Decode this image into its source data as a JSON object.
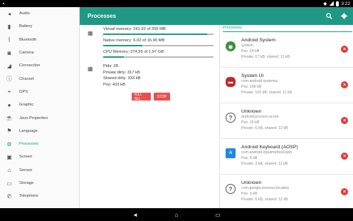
{
  "status_bar": {
    "time": "3:22"
  },
  "sidebar": {
    "items": [
      {
        "label": "Audio",
        "icon": "speaker-icon"
      },
      {
        "label": "Battery",
        "icon": "battery-icon"
      },
      {
        "label": "Bluetooth",
        "icon": "bluetooth-icon"
      },
      {
        "label": "Camera",
        "icon": "camera-icon"
      },
      {
        "label": "Connection",
        "icon": "signal-icon"
      },
      {
        "label": "Charset",
        "icon": "info-icon"
      },
      {
        "label": "GPS",
        "icon": "location-icon"
      },
      {
        "label": "Graphic",
        "icon": "globe-icon"
      },
      {
        "label": "Java Properties",
        "icon": "coffee-icon"
      },
      {
        "label": "Language",
        "icon": "flag-icon"
      },
      {
        "label": "Processes",
        "icon": "processes-icon",
        "active": true
      },
      {
        "label": "Screen",
        "icon": "screen-icon"
      },
      {
        "label": "Sensor",
        "icon": "sensor-icon"
      },
      {
        "label": "Storage",
        "icon": "storage-icon"
      },
      {
        "label": "Telephone",
        "icon": "phone-icon"
      }
    ]
  },
  "appbar": {
    "title": "Processes"
  },
  "memory": {
    "virtual": {
      "label": "Virtual memory: 241.92 of 256 MB",
      "fraction": 0.945
    },
    "native": {
      "label": "Native memory: 6.02 of 16.90 MB",
      "fraction": 0.356
    },
    "cpu": {
      "label": "CPU Memory: 374.55 of 1.97 GB",
      "fraction": 0.186
    }
  },
  "process_detail": {
    "pids": "Pids: 28",
    "private_dirty": "Private dirty: 317 kB",
    "shared_dirty": "Shared dirty: 333 kB",
    "pss": "Pss: 433 kB"
  },
  "buttons": {
    "kill_all": "KILL ALL",
    "stop": "STOP"
  },
  "processes_header": "Processes",
  "processes": [
    {
      "name": "Android System",
      "package": "system",
      "pss": "Pss: 24 kB",
      "mem": "Private: 17 kB, shared: 11 kB",
      "icon": "android-globe-icon",
      "color": "#3a8f3a"
    },
    {
      "name": "System UI",
      "package": "com.android.systemui",
      "pss": "Pss: 106 kB",
      "mem": "Private: 102 kB, shared: 11 kB",
      "icon": "android-red-icon",
      "color": "#c62828"
    },
    {
      "name": "Unknown",
      "package": "android.process.acore",
      "pss": "Pss: 15 kB",
      "mem": "Private: 6 kB, shared: 12 kB",
      "icon": "unknown-icon",
      "color": "#555555"
    },
    {
      "name": "Android Keyboard (AOSP)",
      "package": "com.android.inputmethod.latin",
      "pss": "Pss: 5 kB",
      "mem": "Private: 3 kB, shared: 11 kB",
      "icon": "keyboard-icon",
      "color": "#1e88e5"
    },
    {
      "name": "Unknown",
      "package": "com.google.process.location",
      "pss": "Pss: 3 kB",
      "mem": "Private: 6 kB, shared: 12 kB",
      "icon": "unknown-icon",
      "color": "#555555"
    }
  ]
}
